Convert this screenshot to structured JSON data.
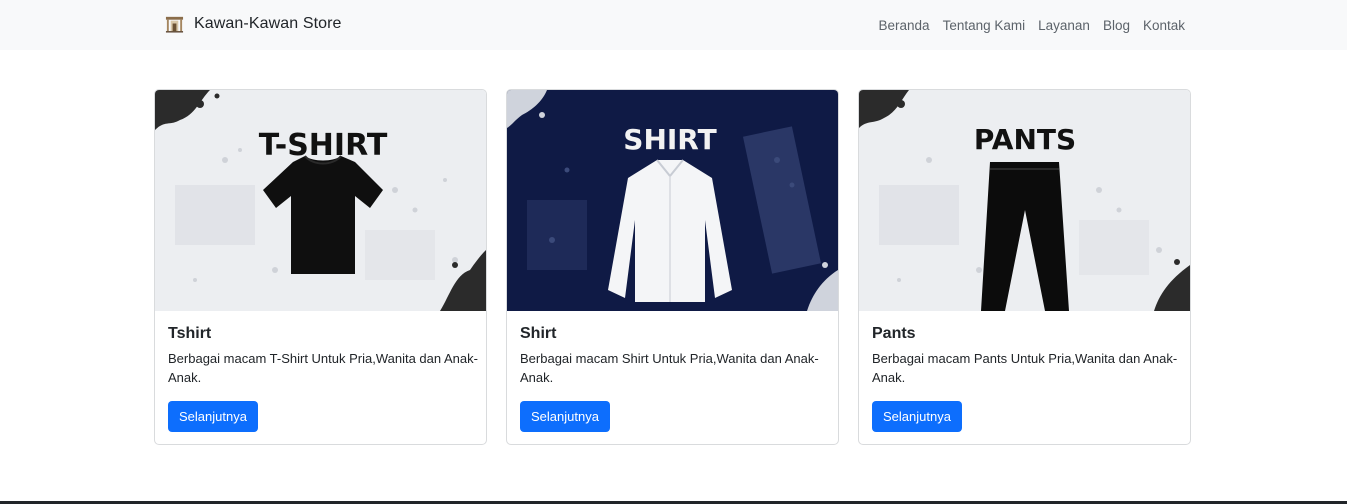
{
  "navbar": {
    "brand": "Kawan-Kawan Store",
    "logo_icon": "store-logo-icon",
    "links": [
      "Beranda",
      "Tentang Kami",
      "Layanan",
      "Blog",
      "Kontak"
    ]
  },
  "cards": [
    {
      "image_label": "T-SHIRT",
      "image_theme": "light",
      "title": "Tshirt",
      "text": "Berbagai macam T-Shirt Untuk Pria,Wanita dan Anak-Anak.",
      "button": "Selanjutnya"
    },
    {
      "image_label": "SHIRT",
      "image_theme": "navy",
      "title": "Shirt",
      "text": "Berbagai macam Shirt Untuk Pria,Wanita dan Anak-Anak.",
      "button": "Selanjutnya"
    },
    {
      "image_label": "PANTS",
      "image_theme": "light",
      "title": "Pants",
      "text": "Berbagai macam Pants Untuk Pria,Wanita dan Anak-Anak.",
      "button": "Selanjutnya"
    }
  ],
  "colors": {
    "primary": "#0d6efd",
    "navbar_bg": "#f8f9fa",
    "navy_bg": "#0f1a45"
  }
}
